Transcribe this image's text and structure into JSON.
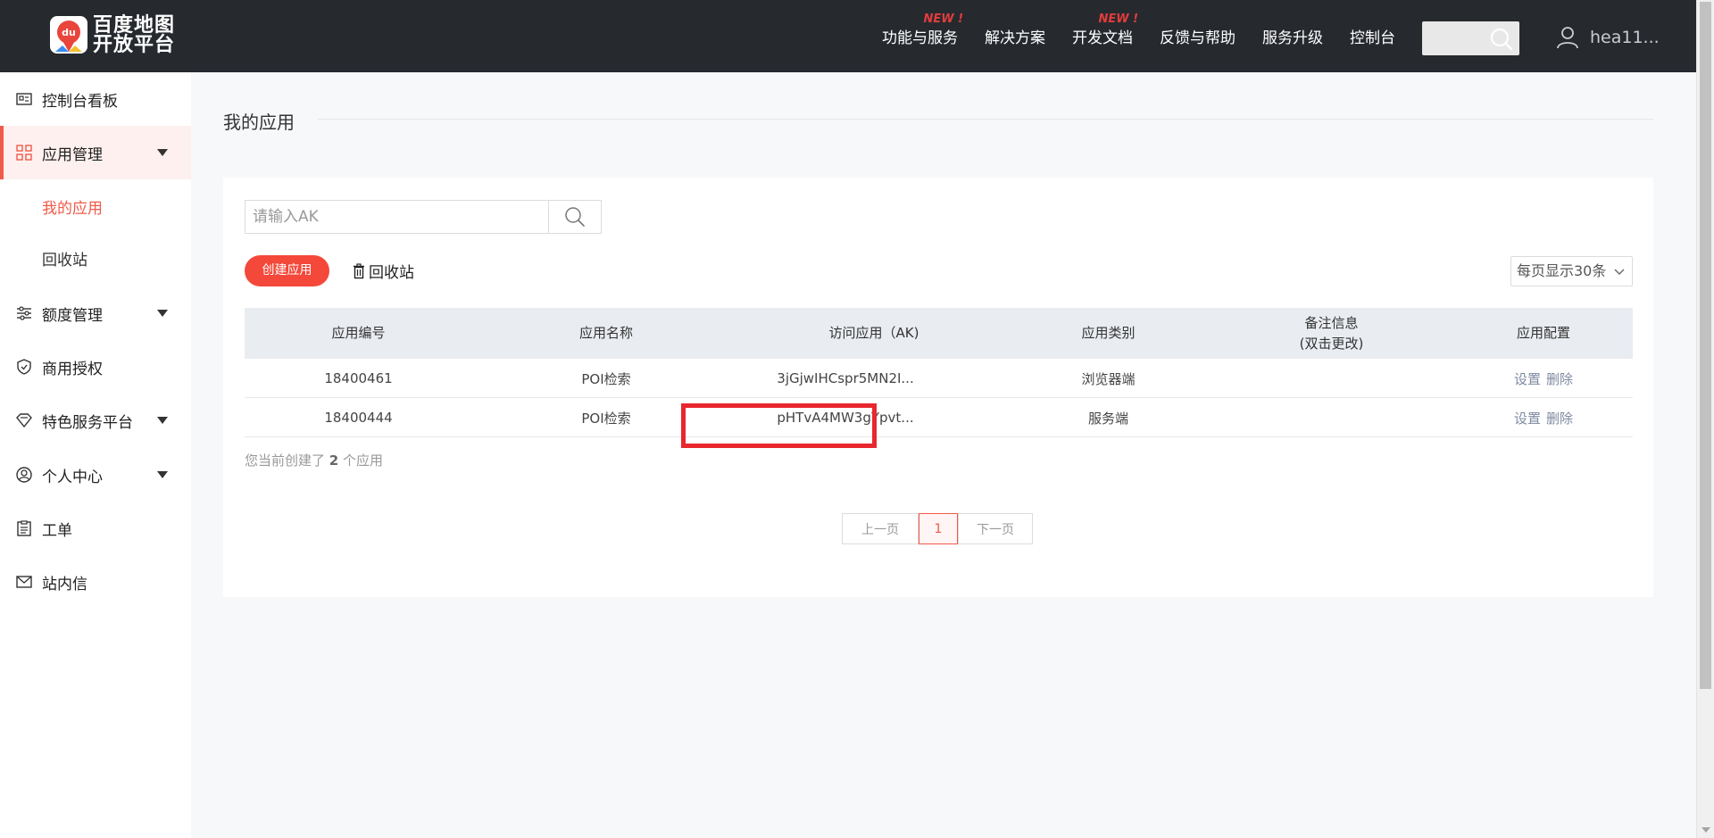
{
  "header": {
    "logo_line1": "百度地图",
    "logo_line2": "开放平台",
    "logo_badge": "du",
    "nav": [
      {
        "label": "功能与服务",
        "badge": "NEW !"
      },
      {
        "label": "解决方案",
        "badge": ""
      },
      {
        "label": "开发文档",
        "badge": "NEW !"
      },
      {
        "label": "反馈与帮助",
        "badge": ""
      },
      {
        "label": "服务升级",
        "badge": ""
      },
      {
        "label": "控制台",
        "badge": ""
      }
    ],
    "search_icon": "search-icon",
    "user_name": "hea11..."
  },
  "sidebar": {
    "items": [
      {
        "label": "控制台看板",
        "icon": "dashboard-icon"
      },
      {
        "label": "应用管理",
        "icon": "grid-icon"
      },
      {
        "label": "我的应用"
      },
      {
        "label": "回收站"
      },
      {
        "label": "额度管理",
        "icon": "sliders-icon"
      },
      {
        "label": "商用授权",
        "icon": "shield-icon"
      },
      {
        "label": "特色服务平台",
        "icon": "diamond-icon"
      },
      {
        "label": "个人中心",
        "icon": "user-circle-icon"
      },
      {
        "label": "工单",
        "icon": "clipboard-icon"
      },
      {
        "label": "站内信",
        "icon": "mail-icon"
      }
    ]
  },
  "main": {
    "title": "我的应用",
    "search_placeholder": "请输入AK",
    "create_label": "创建应用",
    "recycle_label": "回收站",
    "per_page_label": "每页显示30条",
    "table": {
      "headers": [
        "应用编号",
        "应用名称",
        "访问应用（AK)",
        "应用类别",
        "备注信息",
        "(双击更改)",
        "应用配置"
      ],
      "rows": [
        {
          "id": "18400461",
          "name": "POI检索",
          "ak": "3jGjwIHCspr5MN2I...",
          "category": "浏览器端",
          "note": "",
          "op_set": "设置",
          "op_del": "删除"
        },
        {
          "id": "18400444",
          "name": "POI检索",
          "ak": "pHTvA4MW3gYpvt...",
          "category": "服务端",
          "note": "",
          "op_set": "设置",
          "op_del": "删除"
        }
      ]
    },
    "summary_prefix": "您当前创建了",
    "summary_count": "2",
    "summary_suffix": "个应用",
    "pager": {
      "prev": "上一页",
      "current": "1",
      "next": "下一页"
    }
  },
  "colors": {
    "accent": "#f4483a",
    "topbar": "#262a2f",
    "highlight": "#e8272e"
  }
}
